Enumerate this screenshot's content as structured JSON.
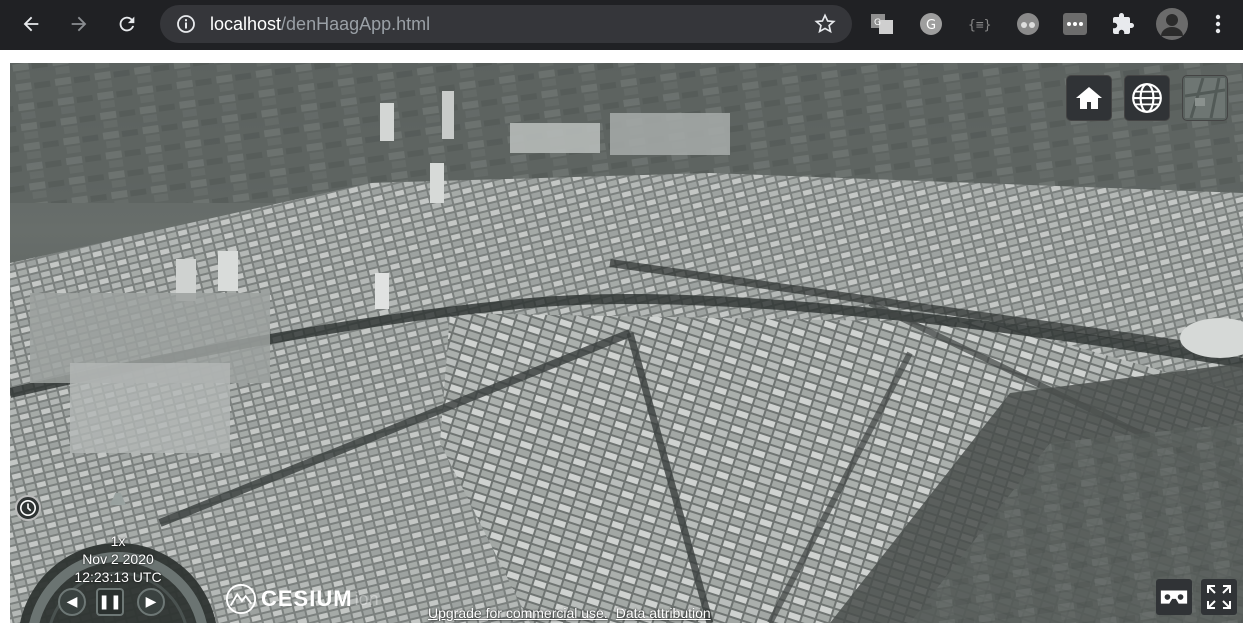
{
  "browser": {
    "url_host": "localhost",
    "url_path": "/denHaagApp.html",
    "icons": [
      "back-icon",
      "forward-icon",
      "reload-icon",
      "info-icon",
      "star-icon",
      "translate-icon",
      "grammarly-icon",
      "json-icon",
      "spy-icon",
      "dots-extension-icon",
      "puzzle-icon",
      "profile-avatar",
      "kebab-menu-icon"
    ]
  },
  "viewer": {
    "animation": {
      "speed": "1x",
      "date": "Nov 2 2020",
      "time": "12:23:13 UTC"
    },
    "logo_text": "CESIUM",
    "logo_suffix": "ion",
    "credits": {
      "upgrade": "Upgrade for commercial use.",
      "attribution": "Data attribution"
    },
    "toolbar": [
      "home-icon",
      "globe-icon",
      "imagery-picker"
    ],
    "colors": {
      "toolbar_bg": "#303336",
      "chrome_bg": "#202124"
    }
  }
}
